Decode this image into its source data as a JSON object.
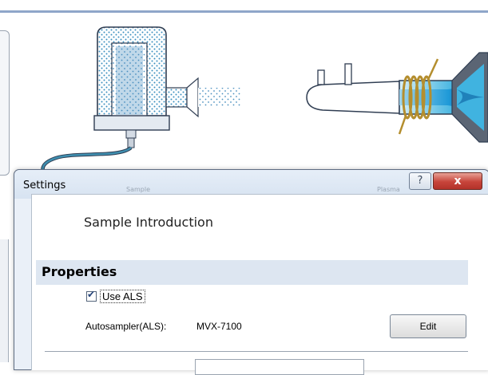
{
  "dialog": {
    "title": "Settings",
    "help_glyph": "?",
    "close_glyph": "x",
    "faint_tab_labels": [
      "Sample",
      "Plasma"
    ]
  },
  "panel": {
    "heading": "Sample Introduction",
    "properties_label": "Properties",
    "use_als": {
      "label": "Use ALS",
      "checked": true
    },
    "autosampler": {
      "label": "Autosampler(ALS):",
      "value": "MVX-7100"
    },
    "edit_label": "Edit"
  },
  "icons": {
    "sample-vessel": "sample-introduction-icon",
    "plasma-torch": "plasma-torch-icon"
  },
  "colors": {
    "dialog_bg": "#eaf0f8",
    "properties_band": "#dde6f1",
    "close_button": "#c7443a",
    "title_rule": "#8fa6c9",
    "tube": "#3f8fb0",
    "coil": "#c8a24a"
  }
}
